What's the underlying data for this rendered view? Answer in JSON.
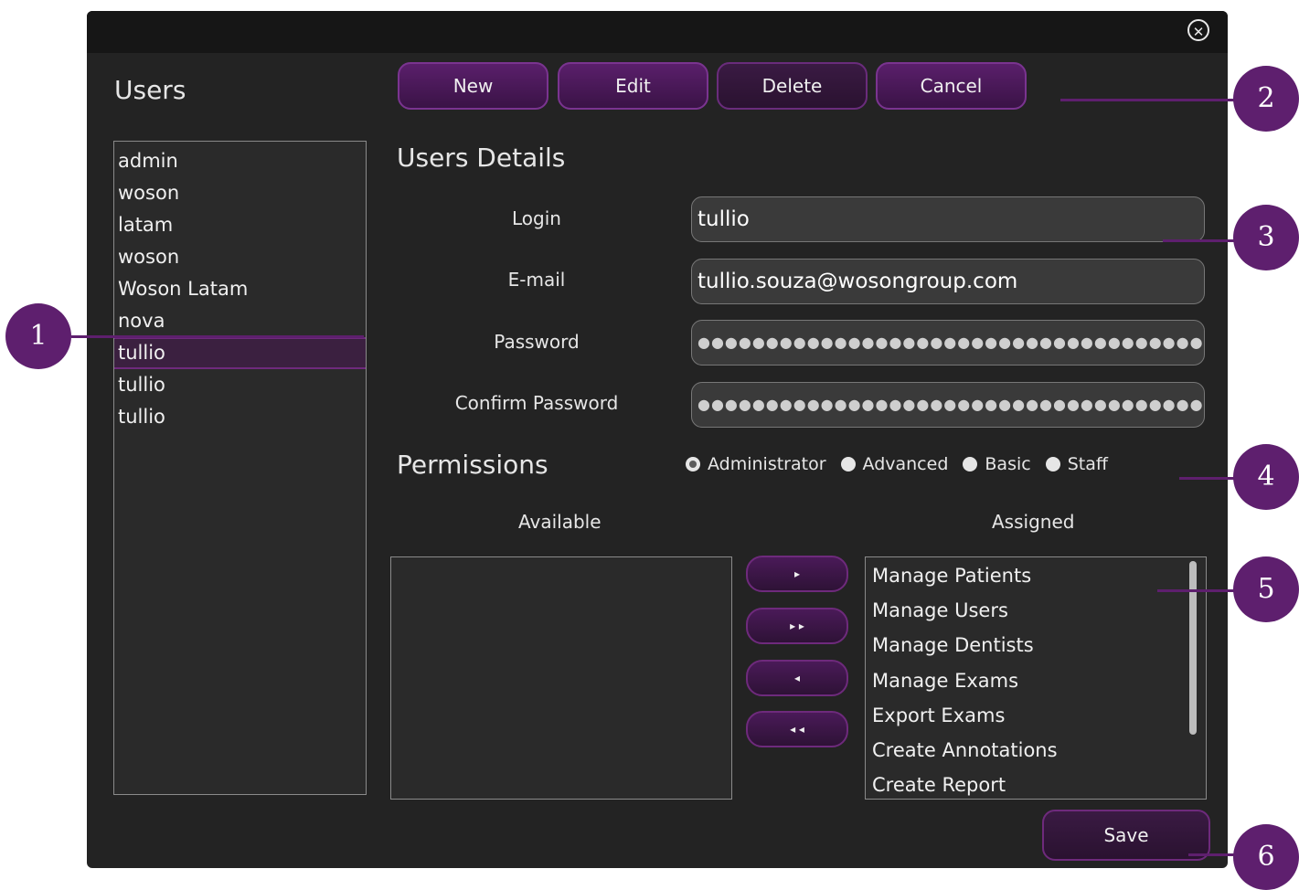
{
  "users_panel": {
    "title": "Users",
    "items": [
      {
        "label": "admin"
      },
      {
        "label": "woson"
      },
      {
        "label": "latam"
      },
      {
        "label": "woson"
      },
      {
        "label": "Woson Latam"
      },
      {
        "label": "nova"
      },
      {
        "label": "tullio",
        "selected": true
      },
      {
        "label": "tullio"
      },
      {
        "label": "tullio"
      }
    ]
  },
  "toolbar": {
    "new_label": "New",
    "edit_label": "Edit",
    "delete_label": "Delete",
    "cancel_label": "Cancel"
  },
  "details": {
    "title": "Users Details",
    "login_label": "Login",
    "login_value": "tullio",
    "email_label": "E-mail",
    "email_value": "tullio.souza@wosongroup.com",
    "password_label": "Password",
    "password_value": "●●●●●●●●●●●●●●●●●●●●●●●●●●●●●●●●●●●●●●●●",
    "confirm_label": "Confirm Password",
    "confirm_value": "●●●●●●●●●●●●●●●●●●●●●●●●●●●●●●●●●●●●●●●●"
  },
  "permissions": {
    "title": "Permissions",
    "levels": [
      {
        "label": "Administrator",
        "checked": true
      },
      {
        "label": "Advanced",
        "checked": false
      },
      {
        "label": "Basic",
        "checked": false
      },
      {
        "label": "Staff",
        "checked": false
      }
    ],
    "available_label": "Available",
    "assigned_label": "Assigned",
    "assigned": [
      "Manage Patients",
      "Manage Users",
      "Manage Dentists",
      "Manage Exams",
      "Export Exams",
      "Create Annotations",
      "Create Report"
    ],
    "arrows": {
      "add_one": "▸",
      "add_all": "▸ ▸",
      "remove_one": "◂",
      "remove_all": "◂ ◂"
    }
  },
  "save_label": "Save",
  "close_glyph": "✕",
  "callouts": [
    "1",
    "2",
    "3",
    "4",
    "5",
    "6"
  ],
  "colors": {
    "accent": "#5e1f6e",
    "dialog_bg": "#232323",
    "titlebar_bg": "#161616"
  }
}
